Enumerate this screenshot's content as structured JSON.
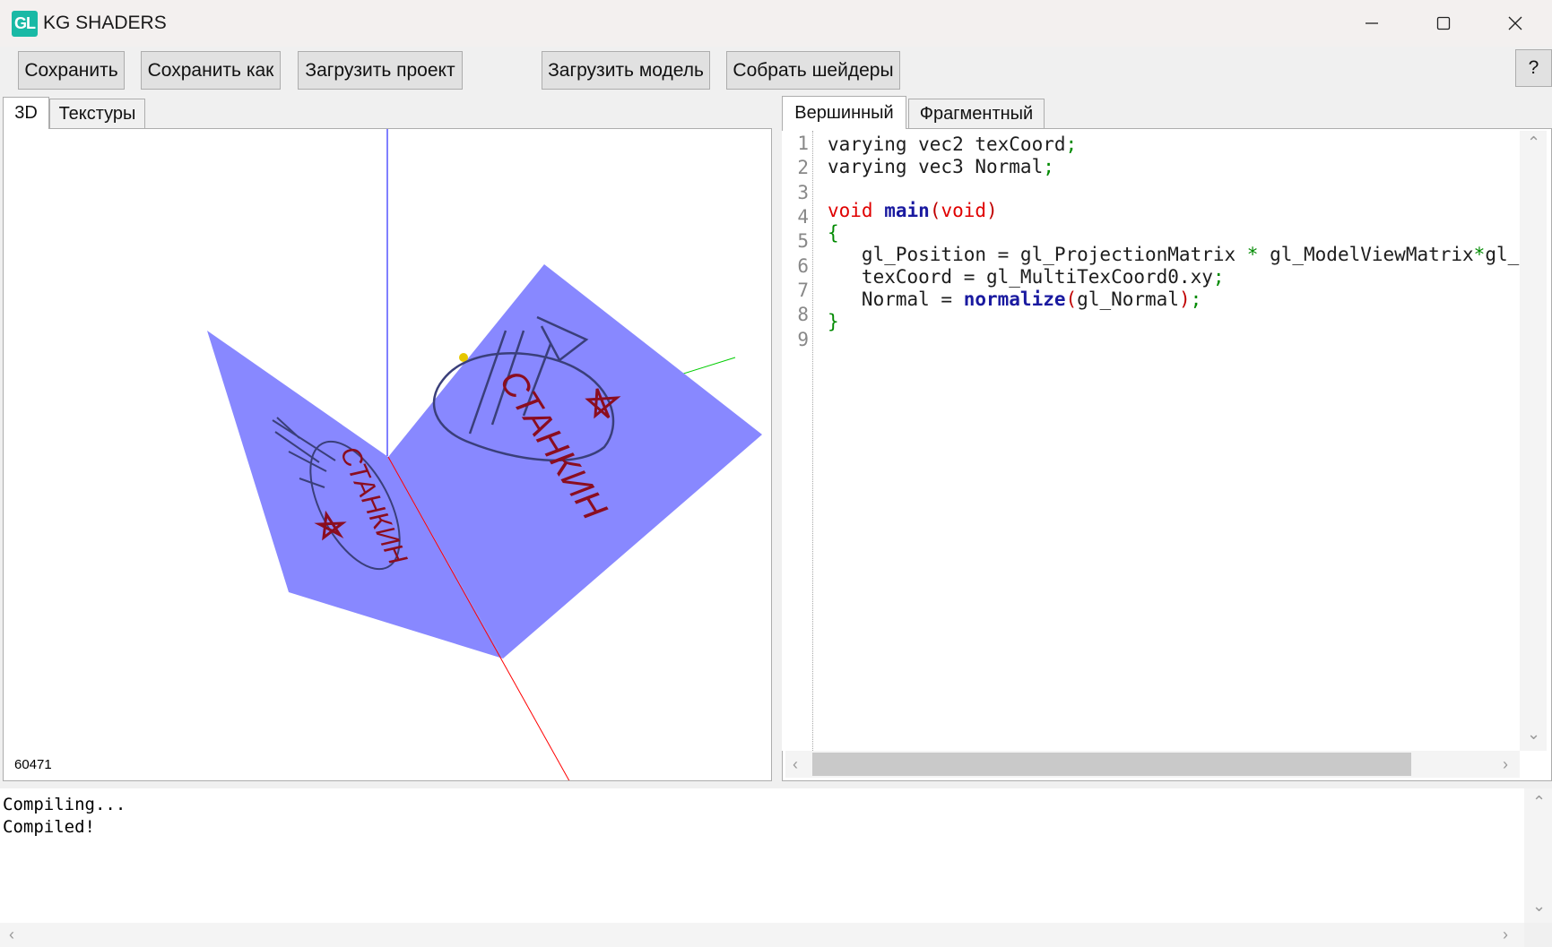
{
  "window": {
    "title": "KG SHADERS",
    "icon_label": "GL",
    "controls": {
      "minimize": "minimize-icon",
      "maximize": "maximize-icon",
      "close": "close-icon"
    }
  },
  "toolbar": {
    "save": "Сохранить",
    "save_as": "Сохранить как",
    "load_project": "Загрузить проект",
    "load_model": "Загрузить модель",
    "build_shaders": "Собрать шейдеры",
    "help": "?"
  },
  "left_tabs": [
    "3D",
    "Текстуры"
  ],
  "right_tabs": [
    "Вершинный",
    "Фрагментный"
  ],
  "viewport": {
    "counter": "60471",
    "texture_label": "СТАНКИН"
  },
  "editor": {
    "line_numbers": [
      "1",
      "2",
      "3",
      "4",
      "5",
      "6",
      "7",
      "8",
      "9"
    ],
    "lines": [
      "varying vec2 texCoord;",
      "varying vec3 Normal;",
      "",
      "void main(void)",
      "{",
      "   gl_Position = gl_ProjectionMatrix * gl_ModelViewMatrix*gl_",
      "   texCoord = gl_MultiTexCoord0.xy;",
      "   Normal = normalize(gl_Normal);",
      "}"
    ]
  },
  "console": {
    "lines": [
      "Compiling...",
      "Compiled!"
    ]
  },
  "colors": {
    "plane": "#8888ff",
    "axis_x": "#ff0000",
    "axis_y": "#00cc00",
    "axis_z": "#0000ff",
    "drawing_dark": "#3a3f7a",
    "drawing_red": "#8b0d1f",
    "light_dot": "#e6c700"
  }
}
